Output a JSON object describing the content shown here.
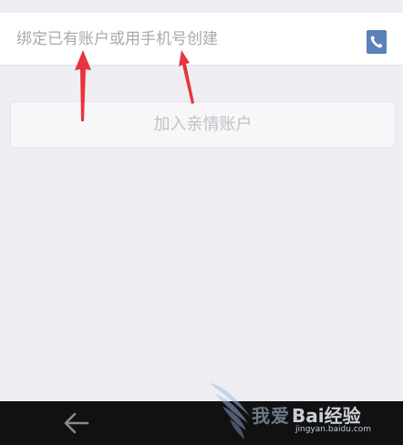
{
  "bind_account": {
    "input_placeholder": "绑定已有账户或用手机号创建",
    "input_value": "",
    "contacts_icon": "phone-contacts-icon"
  },
  "join_button": {
    "label": "加入亲情账户"
  },
  "navigation": {
    "back_icon": "back-arrow-icon"
  },
  "watermark": {
    "slogan": "我爱",
    "logo_text": "Bai经验",
    "url": "jingyan.baidu.com"
  },
  "colors": {
    "background": "#eeeef3",
    "annotation_arrow": "#e8343c",
    "contacts_icon": "#5a82b8",
    "nav_bar": "#111111"
  }
}
